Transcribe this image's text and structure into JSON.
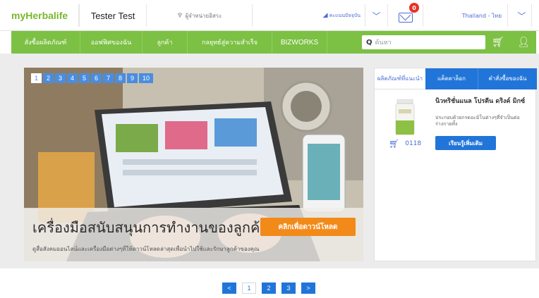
{
  "topbar": {
    "logo": "myHerbalife",
    "user": "Tester Test",
    "store_label": "ผู้จำหน่ายอิสระ",
    "points_label": "คะแนนปัจจุบัน",
    "mail_badge": "0",
    "region": "Thailand - ไทย"
  },
  "nav": {
    "items": [
      "สั่งซื้อผลิตภัณฑ์",
      "ออฟฟิศของฉัน",
      "ลูกค้า",
      "กลยุทธ์สู่ความสำเร็จ",
      "BIZWORKS"
    ],
    "search_placeholder": "ค้นหา"
  },
  "hero": {
    "slide_pages": [
      "1",
      "2",
      "3",
      "4",
      "5",
      "6",
      "7",
      "8",
      "9",
      "10"
    ],
    "active_page": "1",
    "headline": "เครื่องมือสนับสนุนการทำงานของลูกค้า",
    "cta": "คลิกเพื่อดาวน์โหลด",
    "subtext": "ดูสื่อสังคมออนไลน์และเครื่องมือต่างๆที่ให้ดาวน์โหลดล่าสุดเพื่อนำไปใช้และรักษาลูกค้าของคุณ"
  },
  "panel": {
    "tabs": [
      "ผลิตภัณฑ์ที่แนะนำ",
      "แค็ตตาล็อก",
      "คำสั่งซื้อของฉัน"
    ],
    "product_name": "นิวทริชั่นแนล โปรตีน ดริงค์ มิกซ์",
    "product_desc": "ประกอบด้วยกรดอะมิโนต่างๆที่จำเป็นต่อร่างกายทั้ง",
    "product_code": "0118",
    "learn_more": "เรียนรู้เพิ่มเติม"
  },
  "pager": {
    "prev": "<",
    "pages": [
      "1",
      "2",
      "3"
    ],
    "next": ">"
  },
  "colors": {
    "brand_green": "#7cc044",
    "accent_blue": "#2175d9",
    "cta_orange": "#f28a1a",
    "badge_red": "#e53424"
  }
}
